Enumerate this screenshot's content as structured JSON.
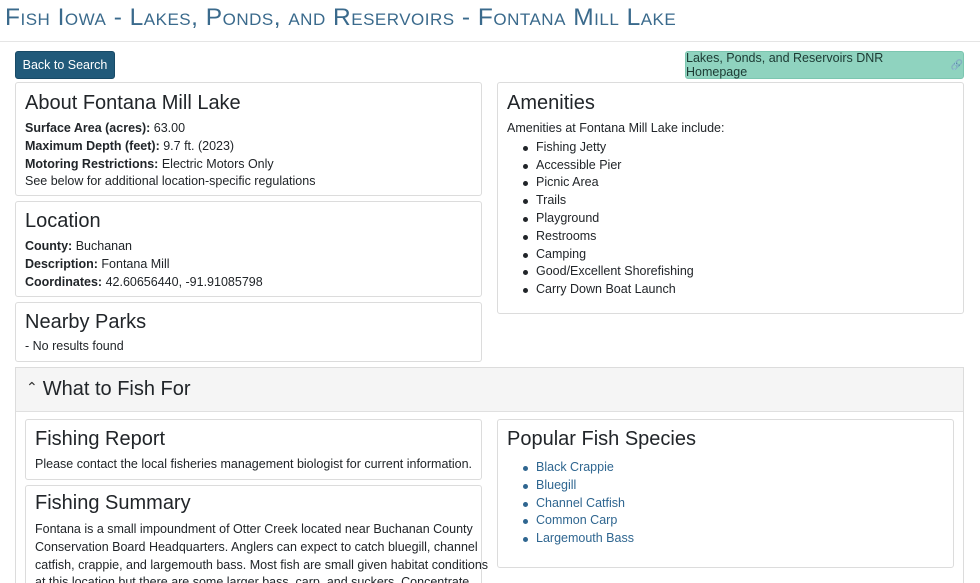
{
  "header": {
    "title": "Fish Iowa - Lakes, Ponds, and Reservoirs - Fontana Mill Lake"
  },
  "toolbar": {
    "back_label": "Back to Search",
    "dnr_label": "Lakes, Ponds, and Reservoirs DNR Homepage",
    "dnr_icon": "external-link-icon"
  },
  "about": {
    "heading": "About Fontana Mill Lake",
    "surface_area_label": "Surface Area (acres):",
    "surface_area_value": "63.00",
    "max_depth_label": "Maximum Depth (feet):",
    "max_depth_value": "9.7 ft. (2023)",
    "motoring_label": "Motoring Restrictions:",
    "motoring_value": "Electric Motors Only",
    "note": "See below for additional location-specific regulations"
  },
  "location": {
    "heading": "Location",
    "county_label": "County:",
    "county_value": "Buchanan",
    "description_label": "Description:",
    "description_value": "Fontana Mill",
    "coordinates_label": "Coordinates:",
    "coordinates_value": "42.60656440, -91.91085798"
  },
  "nearby_parks": {
    "heading": "Nearby Parks",
    "text": "- No results found"
  },
  "amenities": {
    "heading": "Amenities",
    "intro": "Amenities at Fontana Mill Lake include:",
    "items": [
      "Fishing Jetty",
      "Accessible Pier",
      "Picnic Area",
      "Trails",
      "Playground",
      "Restrooms",
      "Camping",
      "Good/Excellent Shorefishing",
      "Carry Down Boat Launch"
    ]
  },
  "what_to_fish": {
    "heading": "What to Fish For",
    "caret_icon": "chevron-up-icon"
  },
  "fishing_report": {
    "heading": "Fishing Report",
    "text": "Please contact the local fisheries management biologist for current information."
  },
  "fishing_summary": {
    "heading": "Fishing Summary",
    "lines": [
      "Fontana is a small impoundment of Otter Creek located near Buchanan County",
      "Conservation Board Headquarters. Anglers can expect to catch bluegill, channel",
      "catfish, crappie, and largemouth bass. Most fish are small given habitat conditions",
      "at this location but there are some larger bass, carp, and suckers. Concentrate"
    ]
  },
  "popular_species": {
    "heading": "Popular Fish Species",
    "items": [
      "Black Crappie",
      "Bluegill",
      "Channel Catfish",
      "Common Carp",
      "Largemouth Bass"
    ]
  }
}
